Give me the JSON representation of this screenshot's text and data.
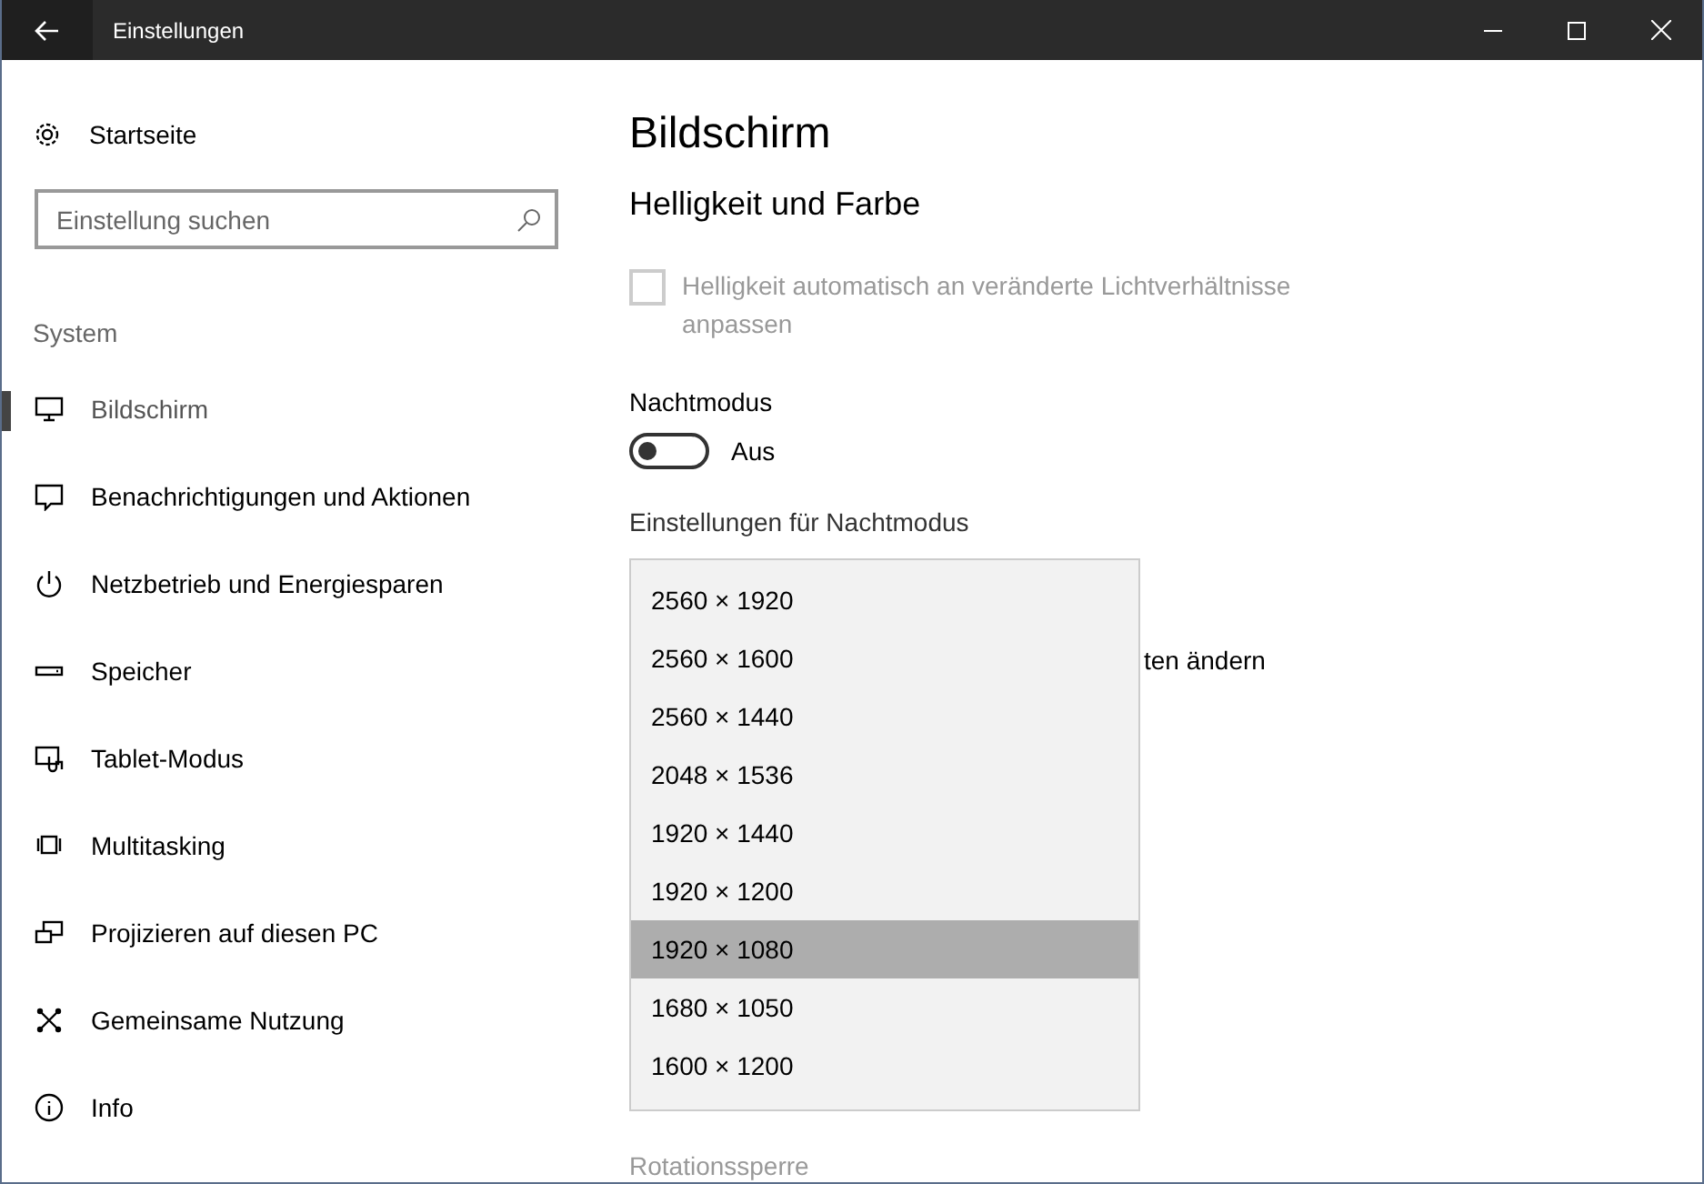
{
  "window": {
    "title": "Einstellungen"
  },
  "sidebar": {
    "home": "Startseite",
    "search": {
      "placeholder": "Einstellung suchen"
    },
    "group": "System",
    "items": [
      {
        "label": "Bildschirm",
        "selected": true
      },
      {
        "label": "Benachrichtigungen und Aktionen",
        "selected": false
      },
      {
        "label": "Netzbetrieb und Energiesparen",
        "selected": false
      },
      {
        "label": "Speicher",
        "selected": false
      },
      {
        "label": "Tablet-Modus",
        "selected": false
      },
      {
        "label": "Multitasking",
        "selected": false
      },
      {
        "label": "Projizieren auf diesen PC",
        "selected": false
      },
      {
        "label": "Gemeinsame Nutzung",
        "selected": false
      },
      {
        "label": "Info",
        "selected": false
      }
    ]
  },
  "content": {
    "title": "Bildschirm",
    "section": "Helligkeit und Farbe",
    "auto_brightness": {
      "label": "Helligkeit automatisch an veränderte Lichtverhältnisse anpassen",
      "checked": false,
      "disabled": true
    },
    "night_mode": {
      "label": "Nachtmodus",
      "on": false,
      "state_text": "Aus"
    },
    "night_settings_link": "Einstellungen für Nachtmodus",
    "covered_text": "ten ändern",
    "rotation_label": "Rotationssperre",
    "resolution_menu": [
      {
        "label": "2560 × 1920",
        "selected": false
      },
      {
        "label": "2560 × 1600",
        "selected": false
      },
      {
        "label": "2560 × 1440",
        "selected": false
      },
      {
        "label": "2048 × 1536",
        "selected": false
      },
      {
        "label": "1920 × 1440",
        "selected": false
      },
      {
        "label": "1920 × 1200",
        "selected": false
      },
      {
        "label": "1920 × 1080",
        "selected": true
      },
      {
        "label": "1680 × 1050",
        "selected": false
      },
      {
        "label": "1600 × 1200",
        "selected": false
      }
    ]
  }
}
